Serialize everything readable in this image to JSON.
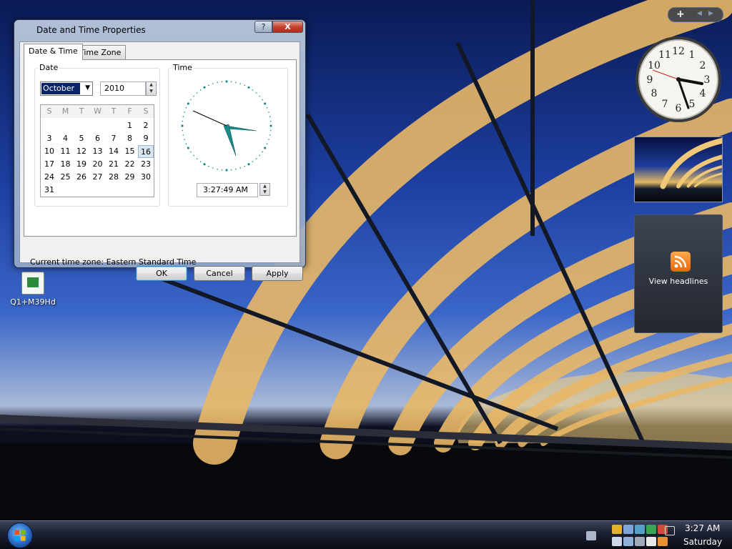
{
  "desktop": {
    "icons": [
      {
        "label": "Q1+M39Hd",
        "icon": "workbook-icon"
      }
    ]
  },
  "window": {
    "title": "Date and Time Properties",
    "help_label": "?",
    "close_label": "X",
    "tabs": [
      {
        "label": "Date & Time",
        "active": true
      },
      {
        "label": "Time Zone",
        "active": false
      }
    ],
    "date_group": {
      "legend": "Date",
      "month": "October",
      "year": "2010",
      "weekday_headers": [
        "S",
        "M",
        "T",
        "W",
        "T",
        "F",
        "S"
      ],
      "weeks": [
        [
          "",
          "",
          "",
          "",
          "",
          "1",
          "2"
        ],
        [
          "3",
          "4",
          "5",
          "6",
          "7",
          "8",
          "9"
        ],
        [
          "10",
          "11",
          "12",
          "13",
          "14",
          "15",
          "16"
        ],
        [
          "17",
          "18",
          "19",
          "20",
          "21",
          "22",
          "23"
        ],
        [
          "24",
          "25",
          "26",
          "27",
          "28",
          "29",
          "30"
        ],
        [
          "31",
          "",
          "",
          "",
          "",
          "",
          ""
        ]
      ],
      "selected_day": "16"
    },
    "time_group": {
      "legend": "Time",
      "time_value": "3:27:49 AM"
    },
    "timezone_label": "Current time zone:  Eastern Standard Time",
    "buttons": {
      "ok": "OK",
      "cancel": "Cancel",
      "apply": "Apply"
    }
  },
  "sidebar": {
    "add_label": "+",
    "feed_label": "View headlines"
  },
  "taskbar": {
    "time": "3:27 AM",
    "day": "Saturday"
  },
  "colors": {
    "selection": "#0a246a",
    "clock_hands": "#1a8a8a",
    "rss": "#f07c1e"
  }
}
